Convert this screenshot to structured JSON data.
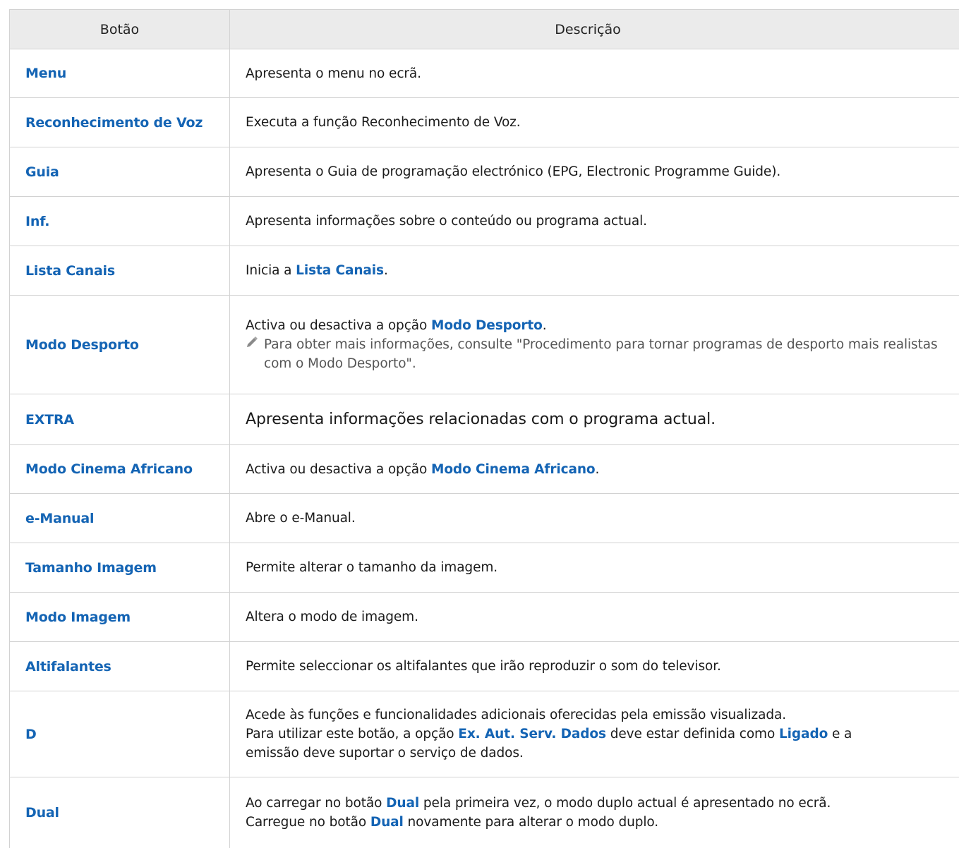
{
  "header": {
    "col1": "Botão",
    "col2": "Descrição"
  },
  "rows": [
    {
      "button": "Menu",
      "desc": "Apresenta o menu no ecrã."
    },
    {
      "button": "Reconhecimento de Voz",
      "desc": "Executa a função Reconhecimento de Voz."
    },
    {
      "button": "Guia",
      "desc": "Apresenta o Guia de programação electrónico (EPG, Electronic Programme Guide)."
    },
    {
      "button": "Inf.",
      "desc": "Apresenta informações sobre o conteúdo ou programa actual."
    },
    {
      "button": "Lista Canais",
      "desc_pre": "Inicia a ",
      "desc_hl": "Lista Canais",
      "desc_post": "."
    },
    {
      "button": "Modo Desporto",
      "desc_pre": "Activa ou desactiva a opção ",
      "desc_hl": "Modo Desporto",
      "desc_post": ".",
      "note": "Para obter mais informações, consulte \"Procedimento para tornar programas de desporto mais realistas com o Modo Desporto\"."
    },
    {
      "button": "EXTRA",
      "desc": "Apresenta informações relacionadas com o programa actual."
    },
    {
      "button": "Modo Cinema Africano",
      "desc_pre": "Activa ou desactiva a opção ",
      "desc_hl": "Modo Cinema Africano",
      "desc_post": "."
    },
    {
      "button": "e-Manual",
      "desc": "Abre o e-Manual."
    },
    {
      "button": "Tamanho Imagem",
      "desc": "Permite alterar o tamanho da imagem."
    },
    {
      "button": "Modo Imagem",
      "desc": "Altera o modo de imagem."
    },
    {
      "button": "Altifalantes",
      "desc": "Permite seleccionar os altifalantes que irão reproduzir o som do televisor."
    },
    {
      "button": "D",
      "line1": "Acede às funções e funcionalidades adicionais oferecidas pela emissão visualizada.",
      "line2_a": "Para utilizar este botão, a opção ",
      "line2_hl1": "Ex. Aut. Serv. Dados",
      "line2_b": " deve estar definida como ",
      "line2_hl2": "Ligado",
      "line2_c": " e a",
      "line3": "emissão deve suportar o serviço de dados."
    },
    {
      "button": "Dual",
      "line1_a": "Ao carregar no botão ",
      "line1_hl": "Dual",
      "line1_b": " pela primeira vez, o modo duplo actual é apresentado no ecrã.",
      "line2_a": "Carregue no botão ",
      "line2_hl": "Dual",
      "line2_b": " novamente para alterar o modo duplo."
    }
  ]
}
